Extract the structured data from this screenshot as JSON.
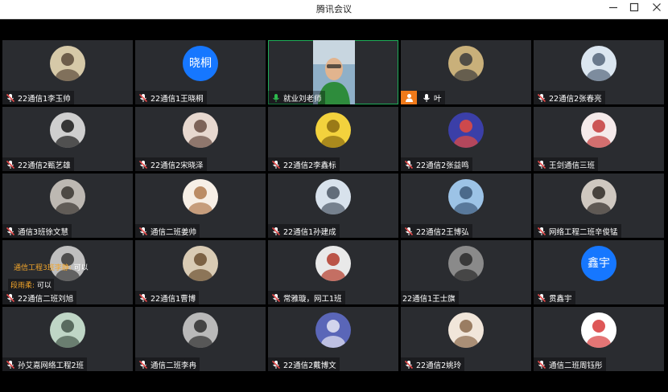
{
  "window": {
    "title": "腾讯会议",
    "minimize_icon": "minimize-icon",
    "maximize_icon": "maximize-icon",
    "close_icon": "close-icon"
  },
  "colors": {
    "speaking_border": "#1fae5a",
    "muted_mic": "#e24a4a",
    "active_mic": "#2dbb4e",
    "avatar_text_bg": "#1677ff",
    "host_badge": "#f07a1a",
    "chat_sender": "#f3a62b"
  },
  "participants": [
    {
      "name": "22通信1李玉帅",
      "mic": "muted",
      "avatar": "photo"
    },
    {
      "name": "22通信1王晓桐",
      "mic": "muted",
      "avatar": "text",
      "avatar_text": "晓桐"
    },
    {
      "name": "就业刘老师",
      "mic": "active",
      "avatar": "video"
    },
    {
      "name": "叶",
      "mic": "unmuted",
      "avatar": "photo",
      "badge": "person-icon"
    },
    {
      "name": "22通信2张春亮",
      "mic": "muted",
      "avatar": "photo"
    },
    {
      "name": "22通信2甄艺雄",
      "mic": "muted",
      "avatar": "photo"
    },
    {
      "name": "22通信2宋晓泽",
      "mic": "muted",
      "avatar": "photo"
    },
    {
      "name": "22通信2李鑫标",
      "mic": "muted",
      "avatar": "photo"
    },
    {
      "name": "22通信2张益鸣",
      "mic": "muted",
      "avatar": "photo"
    },
    {
      "name": "王剑通信三班",
      "mic": "muted",
      "avatar": "photo"
    },
    {
      "name": "通信3班徐文慧",
      "mic": "muted",
      "avatar": "photo"
    },
    {
      "name": "通信二班姜帅",
      "mic": "muted",
      "avatar": "photo"
    },
    {
      "name": "22通信1孙建成",
      "mic": "muted",
      "avatar": "photo"
    },
    {
      "name": "22通信2王博弘",
      "mic": "muted",
      "avatar": "photo"
    },
    {
      "name": "网络工程二班辛俊锰",
      "mic": "muted",
      "avatar": "photo"
    },
    {
      "name": "22通信二班刘旭",
      "mic": "muted",
      "avatar": "photo"
    },
    {
      "name": "22通信1曹博",
      "mic": "muted",
      "avatar": "photo"
    },
    {
      "name": "常雅璇，网工1班",
      "mic": "muted",
      "avatar": "photo"
    },
    {
      "name": "22通信1王士旗",
      "mic": "none",
      "avatar": "photo"
    },
    {
      "name": "贯鑫宇",
      "mic": "muted",
      "avatar": "text",
      "avatar_text": "鑫宇"
    },
    {
      "name": "孙艾嘉网络工程2班",
      "mic": "muted",
      "avatar": "photo"
    },
    {
      "name": "通信二班李冉",
      "mic": "muted",
      "avatar": "photo"
    },
    {
      "name": "22通信2戴博文",
      "mic": "muted",
      "avatar": "photo"
    },
    {
      "name": "22通信2姚玲",
      "mic": "muted",
      "avatar": "photo"
    },
    {
      "name": "通信二班周钰彤",
      "mic": "muted",
      "avatar": "photo"
    }
  ],
  "chat_overlay": [
    {
      "sender": "通信工程3班李静:",
      "message": "可以"
    },
    {
      "sender": "段雨柔:",
      "message": "可以"
    }
  ]
}
